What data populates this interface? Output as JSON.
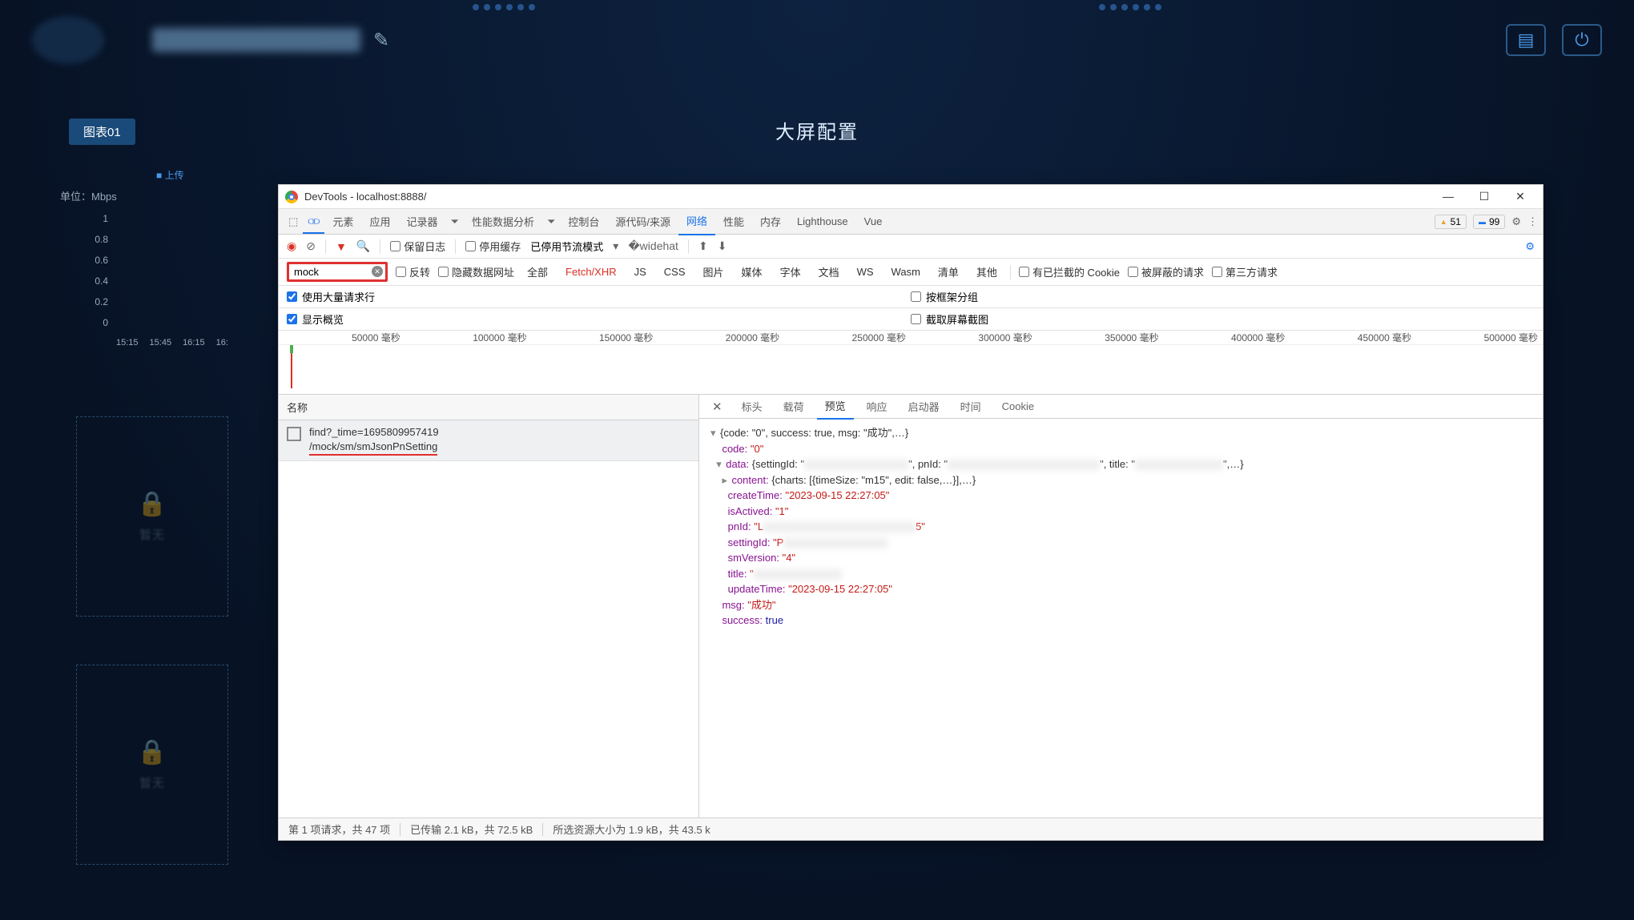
{
  "dashboard": {
    "center_title": "大屏配置",
    "panel_tag": "图表01",
    "chart_legend": "■ 上传",
    "chart_unit": "单位：Mbps",
    "y_ticks": [
      "1",
      "0.8",
      "0.6",
      "0.4",
      "0.2",
      "0"
    ],
    "x_ticks": [
      "15:15",
      "15:45",
      "16:15",
      "16:"
    ],
    "empty_text": "暂无"
  },
  "devtools": {
    "title": "DevTools - localhost:8888/",
    "win": {
      "min": "—",
      "max": "☐",
      "close": "✕"
    },
    "tabs": [
      "元素",
      "应用",
      "记录器",
      "性能数据分析",
      "控制台",
      "源代码/来源",
      "网络",
      "性能",
      "内存",
      "Lighthouse",
      "Vue"
    ],
    "active_tab": "网络",
    "badges": {
      "warn": "51",
      "info": "99"
    },
    "toolbar": {
      "keep_log": "保留日志",
      "disable_cache": "停用缓存",
      "throttle": "已停用节流模式"
    },
    "filter": {
      "value": "mock",
      "invert": "反转",
      "hide_data": "隐藏数据网址",
      "types": [
        "全部",
        "Fetch/XHR",
        "JS",
        "CSS",
        "图片",
        "媒体",
        "字体",
        "文档",
        "WS",
        "Wasm",
        "清单",
        "其他"
      ],
      "active_type": "Fetch/XHR",
      "blocked_cookies": "有已拦截的 Cookie",
      "blocked_req": "被屏蔽的请求",
      "third_party": "第三方请求"
    },
    "opts": {
      "big_rows": "使用大量请求行",
      "group_frame": "按框架分组",
      "overview": "显示概览",
      "screenshots": "截取屏幕截图"
    },
    "timeline_labels": [
      "50000 毫秒",
      "100000 毫秒",
      "150000 毫秒",
      "200000 毫秒",
      "250000 毫秒",
      "300000 毫秒",
      "350000 毫秒",
      "400000 毫秒",
      "450000 毫秒",
      "500000 毫秒"
    ],
    "req_header": "名称",
    "req_item": {
      "line1": "find?_time=1695809957419",
      "line2": "/mock/sm/smJsonPnSetting"
    },
    "detail_tabs": [
      "标头",
      "载荷",
      "预览",
      "响应",
      "启动器",
      "时间",
      "Cookie"
    ],
    "active_detail": "预览",
    "json": {
      "root": "{code: \"0\", success: true, msg: \"成功\",…}",
      "code_k": "code:",
      "code_v": "\"0\"",
      "data_k": "data:",
      "data_v": "{settingId: \"",
      "data_mid1": "\", pnId: \"",
      "data_mid2": "\", title: \"",
      "data_end": "\",…}",
      "content_k": "content:",
      "content_v": "{charts: [{timeSize: \"m15\", edit: false,…}],…}",
      "createTime_k": "createTime:",
      "createTime_v": "\"2023-09-15 22:27:05\"",
      "isActived_k": "isActived:",
      "isActived_v": "\"1\"",
      "pnId_k": "pnId:",
      "pnId_v_pre": "\"L",
      "pnId_v_suf": "5\"",
      "settingId_k": "settingId:",
      "settingId_v_pre": "\"P",
      "smVersion_k": "smVersion:",
      "smVersion_v": "\"4\"",
      "title_k": "title:",
      "title_v_pre": "\"",
      "updateTime_k": "updateTime:",
      "updateTime_v": "\"2023-09-15 22:27:05\"",
      "msg_k": "msg:",
      "msg_v": "\"成功\"",
      "success_k": "success:",
      "success_v": "true"
    },
    "status": {
      "s1": "第 1 项请求，共 47 项",
      "s2": "已传输 2.1 kB，共 72.5 kB",
      "s3": "所选资源大小为 1.9 kB，共 43.5 k"
    }
  }
}
